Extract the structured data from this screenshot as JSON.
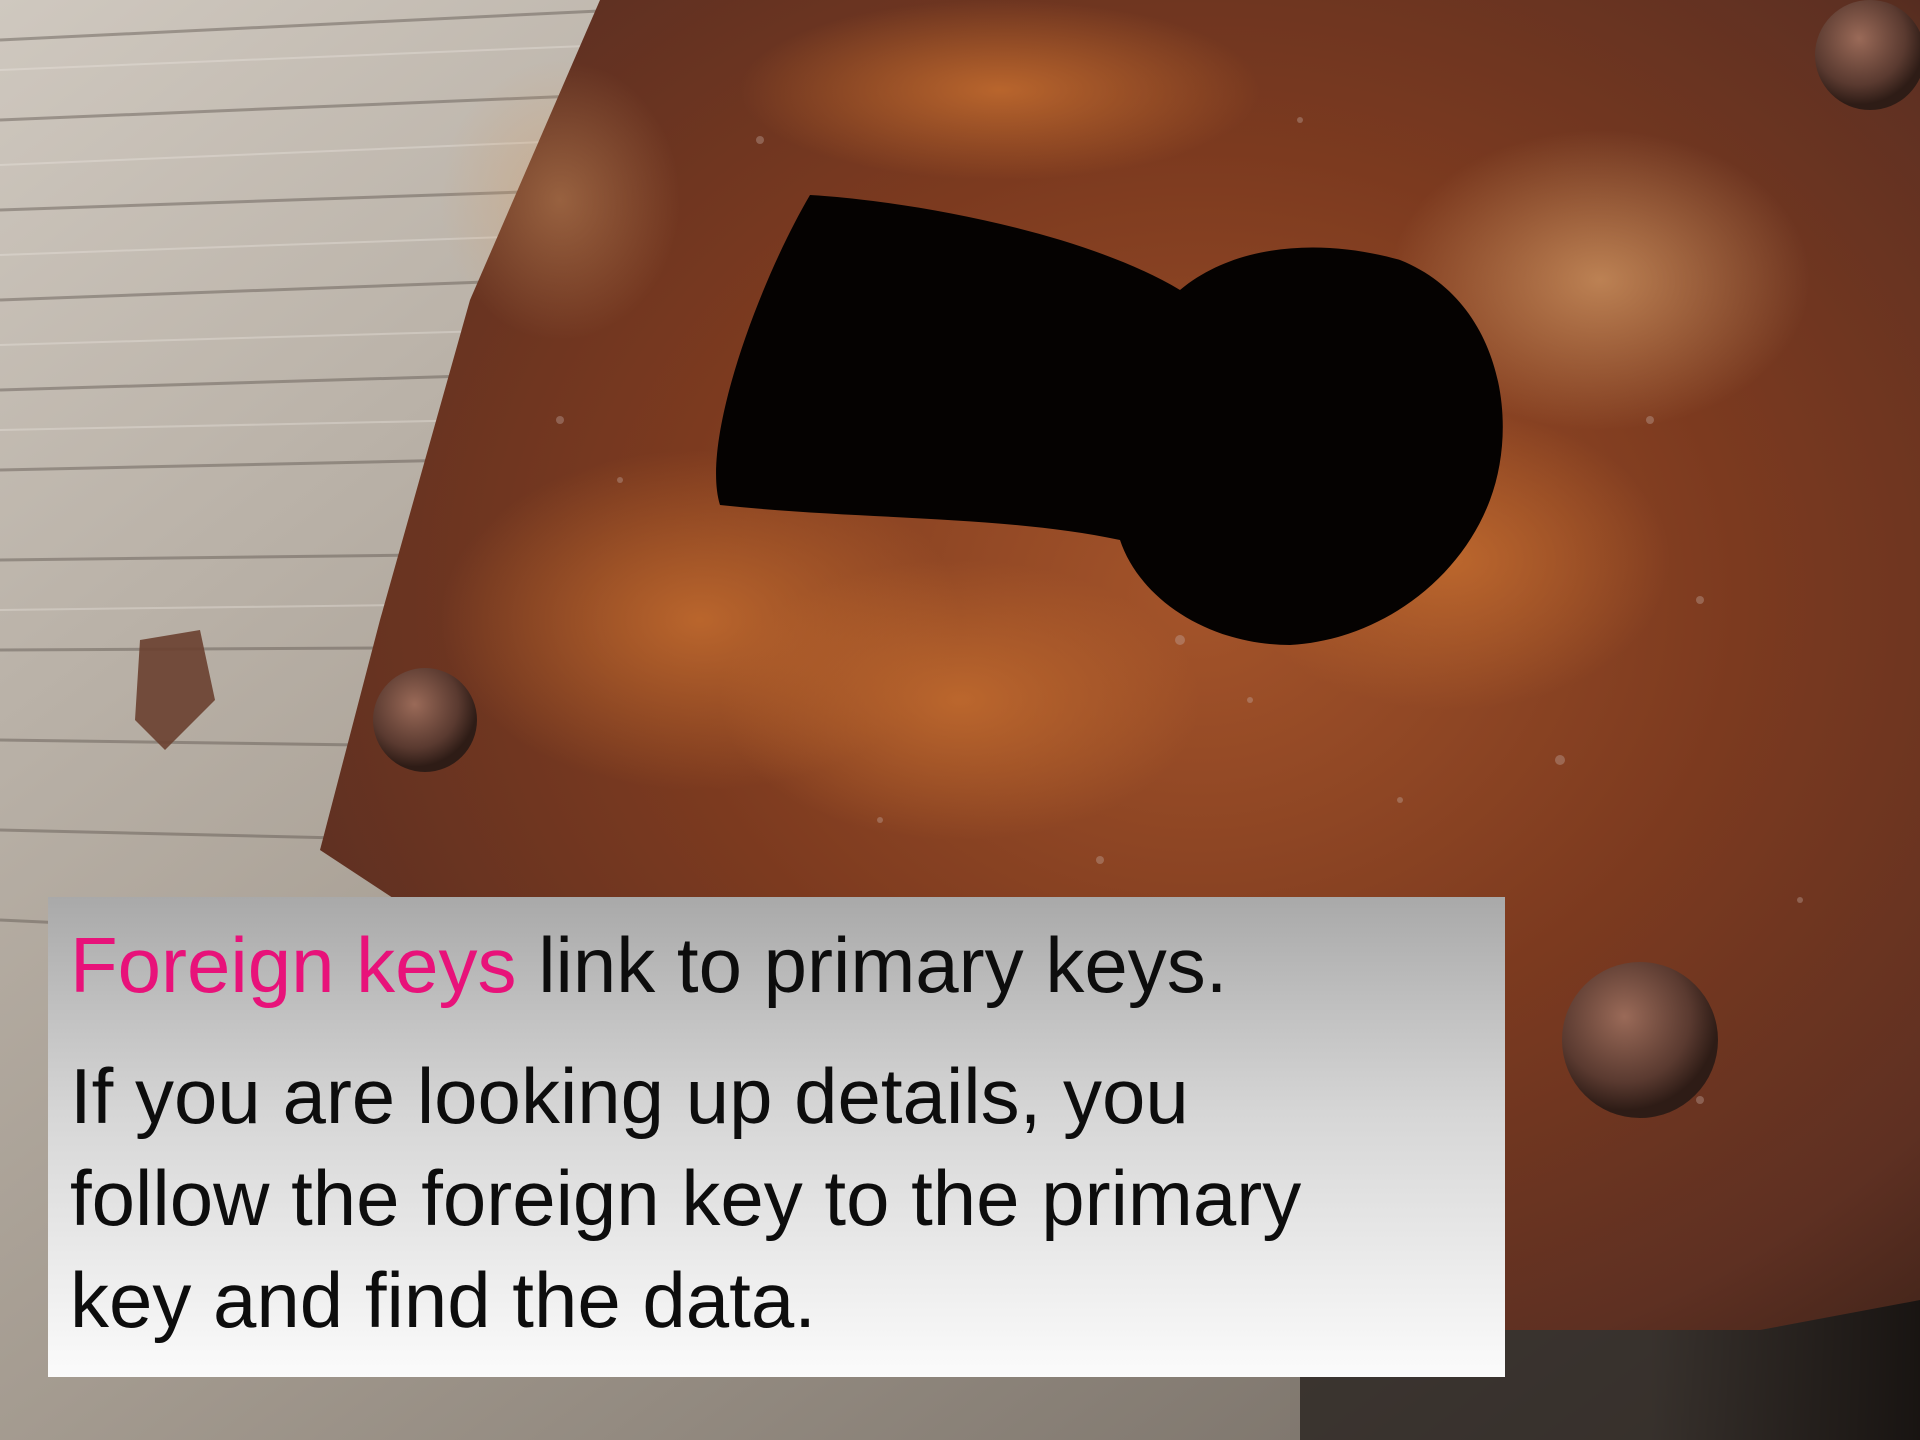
{
  "slide": {
    "background": {
      "subject": "rusty-keyhole-plate-on-weathered-wood",
      "colors": {
        "rust": "#7a3a1c",
        "rust_light": "#b5652c",
        "wood": "#9c948a",
        "keyhole": "#000000"
      }
    },
    "caption": {
      "line1": {
        "highlight": "Foreign keys",
        "rest": " link to primary keys.",
        "highlight_color": "#e8127a"
      },
      "paragraph2": {
        "lines": [
          "If you are looking up details, you",
          "follow the foreign key to the primary",
          "key and find the data."
        ]
      }
    }
  }
}
